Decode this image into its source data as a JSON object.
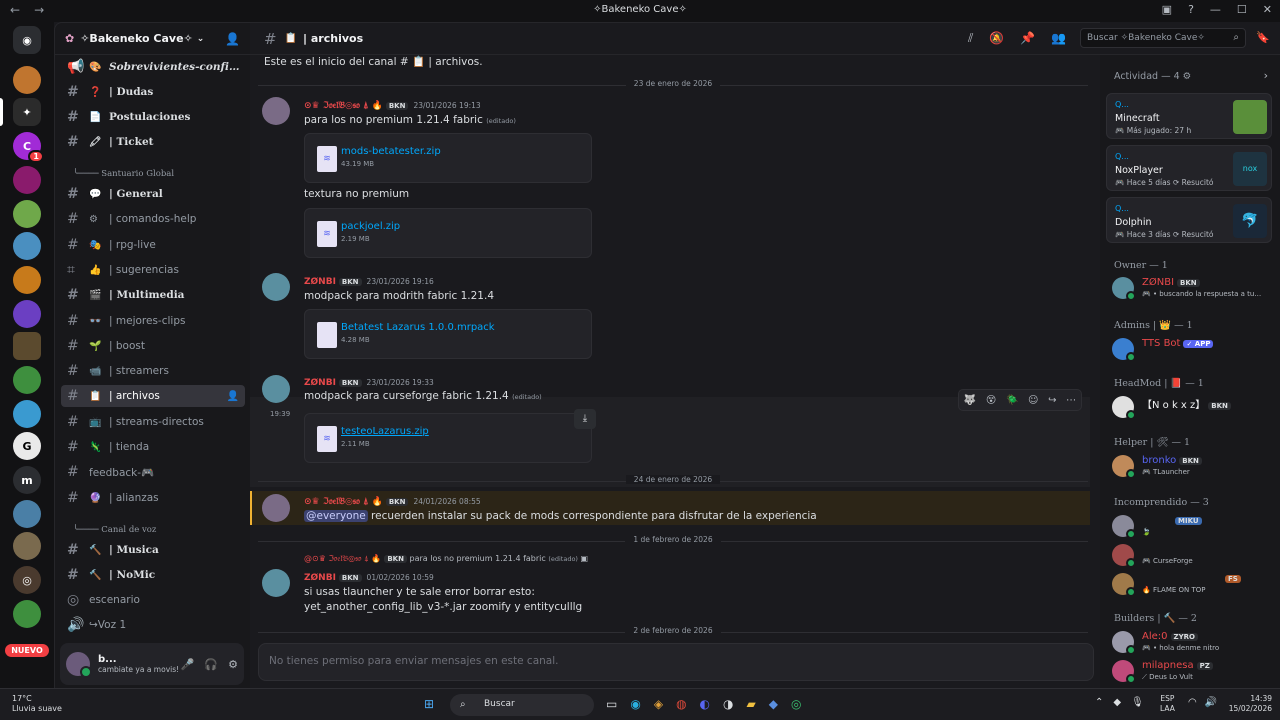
{
  "window": {
    "title": "✧Bakeneko Cave✧",
    "back": "←",
    "forward": "→",
    "min": "—",
    "max": "☐",
    "close": "✕"
  },
  "server": {
    "name": "✧Bakeneko Cave✧",
    "nuevo_badge": "NUEVO",
    "badge_count": "1"
  },
  "channels": [
    {
      "emoji": "🎨",
      "label": "𝑺𝒐𝒃𝒓𝒆𝒗𝒊𝒗𝒊𝒆𝒏𝒕𝒆𝒔-𝒄𝒐𝒏𝒇𝒊…"
    },
    {
      "emoji": "❓",
      "label": "| Dudas"
    },
    {
      "emoji": "📄",
      "label": "Postulaciones"
    },
    {
      "emoji": "🖍",
      "label": "| Ticket"
    },
    {
      "emoji": "💬",
      "label": "| General"
    },
    {
      "emoji": "⚙",
      "label": "| comandos-help"
    },
    {
      "emoji": "🎭",
      "label": "| rpg-live"
    },
    {
      "emoji": "👍",
      "label": "| sugerencias"
    },
    {
      "emoji": "🎬",
      "label": "| Multimedia"
    },
    {
      "emoji": "👓",
      "label": "| mejores-clips"
    },
    {
      "emoji": "🌱",
      "label": "| boost"
    },
    {
      "emoji": "📹",
      "label": "| streamers"
    },
    {
      "emoji": "📋",
      "label": "| archivos"
    },
    {
      "emoji": "📺",
      "label": "| streams-directos"
    },
    {
      "emoji": "🦎",
      "label": "| tienda"
    },
    {
      "emoji": "",
      "label": "feedback-🎮"
    },
    {
      "emoji": "🔮",
      "label": "| alianzas"
    },
    {
      "emoji": "🔨",
      "label": "| Musica"
    },
    {
      "emoji": "🔨",
      "label": "| NoMic"
    },
    {
      "emoji": "",
      "label": "escenario"
    },
    {
      "emoji": "",
      "label": "↪Voz 1"
    }
  ],
  "categories": {
    "santuario": "╰──── Santuario Global",
    "voz": "╰──── Canal de voz"
  },
  "user": {
    "name": "b...",
    "status": "cambiate ya a movis!",
    "mic": "🎤",
    "headphones": "🎧",
    "settings": "⚙"
  },
  "channel_header": {
    "name": "| archivos",
    "emoji": "📋"
  },
  "intro_text": "Este es el inicio del canal # 📋 | archivos.",
  "dates": [
    "23 de enero de 2026",
    "24 de enero de 2026",
    "1 de febrero de 2026",
    "2 de febrero de 2026"
  ],
  "messages": [
    {
      "user": "⊙♛ ℑ𝔬𝔢𝔩𝔅◎𝔰𝔬 ⍋ 🔥",
      "tag": "BKN",
      "time": "23/01/2026 19:13",
      "text": "para los no premium 1.21.4 fabric",
      "edited": "(editado)",
      "files": [
        {
          "name": "mods-betatester.zip",
          "size": "43.19 MB"
        }
      ],
      "text2": "textura no premium",
      "files2": [
        {
          "name": "packjoel.zip",
          "size": "2.19 MB"
        }
      ]
    },
    {
      "user": "ZØNBI",
      "tag": "BKN",
      "time": "23/01/2026 19:16",
      "text": "modpack para modrith fabric 1.21.4",
      "files": [
        {
          "name": "Betatest Lazarus 1.0.0.mrpack",
          "size": "4.28 MB"
        }
      ]
    },
    {
      "user": "ZØNBI",
      "tag": "BKN",
      "time": "23/01/2026 19:33",
      "text": "modpack para curseforge  fabric 1.21.4",
      "edited": "(editado)",
      "hover_time": "19:39",
      "files": [
        {
          "name": "testeoLazarus.zip",
          "size": "2.11 MB"
        }
      ]
    },
    {
      "user": "⊙♛ ℑ𝔬𝔢𝔩𝔅◎𝔰𝔬 ⍋ 🔥",
      "tag": "BKN",
      "time": "24/01/2026 08:55",
      "mention": "@everyone",
      "text": " recuerden instalar su pack de mods correspondiente para disfrutar de la experiencia"
    },
    {
      "reply_user": "@⊙♛ ℑ𝔬𝔢𝔩𝔅◎𝔰𝔬 ⍋ 🔥",
      "reply_tag": "BKN",
      "reply_text": "para los no premium 1.21.4 fabric",
      "reply_edited": "(editado)",
      "user": "ZØNBI",
      "tag": "BKN",
      "time": "01/02/2026 10:59",
      "text": "si usas tlauncher y te sale error borrar esto:",
      "text2": "yet_another_config_lib_v3-*.jar zoomify y entityculllg"
    }
  ],
  "composer_placeholder": "No tienes permiso para enviar mensajes en este canal.",
  "search_placeholder": "Buscar ✧Bakeneko Cave✧",
  "activity": {
    "header": "Actividad — 4",
    "cards": [
      {
        "q": "Q...",
        "game": "Minecraft",
        "sub": "🎮 Más jugado: 27 h"
      },
      {
        "q": "Q...",
        "game": "NoxPlayer",
        "sub": "🎮 Hace 5 días  ⟳ Resucitó"
      },
      {
        "q": "Q...",
        "game": "Dolphin",
        "sub": "🎮 Hace 3 días  ⟳ Resucitó"
      }
    ]
  },
  "member_groups": [
    {
      "label": "Owner — 1",
      "members": [
        {
          "name": "ZØNBI",
          "tag": "BKN",
          "sub": "🎮 • buscando la respuesta a tu…",
          "color": "#e8494b"
        }
      ]
    },
    {
      "label": "Admins  |  👑 — 1",
      "members": [
        {
          "name": "TTS Bot",
          "tag": "✓ APP",
          "sub": "",
          "color": "#e8494b"
        }
      ]
    },
    {
      "label": "HeadMod  |  📕 — 1",
      "members": [
        {
          "name": "【N o k x z】",
          "tag": "BKN",
          "sub": "",
          "color": "#f2f3f5"
        }
      ]
    },
    {
      "label": "Helper  |  🛠 — 1",
      "members": [
        {
          "name": "bronko",
          "tag": "BKN",
          "sub": "🎮 TLauncher",
          "color": "#5865f2"
        }
      ]
    },
    {
      "label": "Incomprendido — 3",
      "members": [
        {
          "name": "",
          "tag": "MIKU",
          "sub": "🍃",
          "color": "#f2f3f5"
        },
        {
          "name": "",
          "tag": "",
          "sub": "🎮 CurseForge",
          "color": "#f2f3f5"
        },
        {
          "name": "",
          "tag": "FS",
          "sub": "🔥 FLAME ON TOP",
          "color": "#f2f3f5"
        }
      ]
    },
    {
      "label": "Builders  |  🔨 — 2",
      "members": [
        {
          "name": "Ale:0",
          "tag": "ZYRO",
          "sub": "🎮 • hola denme nitro",
          "color": "#e8494b"
        },
        {
          "name": "milapnesa",
          "tag": "PZ",
          "sub": "⟋ Deus Lo Vult",
          "color": "#e8494b"
        }
      ]
    }
  ],
  "taskbar": {
    "temp": "17°C",
    "weather": "Lluvia suave",
    "search": "Buscar",
    "lang1": "ESP",
    "lang2": "LAA",
    "time": "14:39",
    "date": "15/02/2026"
  }
}
